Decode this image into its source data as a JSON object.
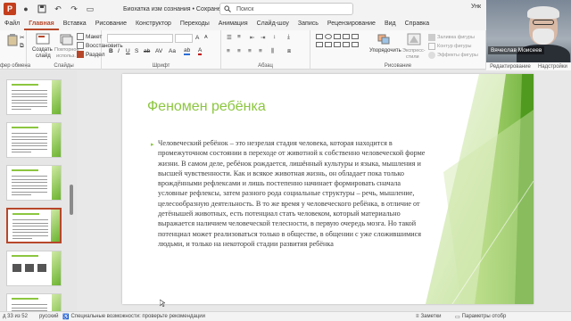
{
  "window": {
    "title": "Биохатка изм сознания • Сохранено в: этот компьютер",
    "search_placeholder": "Поиск",
    "user_name": "Вячеслав Моисеев",
    "user_short": "Унк"
  },
  "tabs": [
    {
      "label": "Файл"
    },
    {
      "label": "Главная",
      "active": true
    },
    {
      "label": "Вставка"
    },
    {
      "label": "Рисование"
    },
    {
      "label": "Конструктор"
    },
    {
      "label": "Переходы"
    },
    {
      "label": "Анимация"
    },
    {
      "label": "Слайд-шоу"
    },
    {
      "label": "Запись"
    },
    {
      "label": "Рецензирование"
    },
    {
      "label": "Вид"
    },
    {
      "label": "Справка"
    }
  ],
  "ribbon": {
    "groups": {
      "clipboard": "фер обмена",
      "slides": "Слайды",
      "font": "Шрифт",
      "paragraph": "Абзац",
      "drawing": "Рисование",
      "editing": "Редактирование",
      "addins": "Надстройки"
    },
    "slides": {
      "new_slide_line1": "Создать",
      "new_slide_line2": "слайд",
      "reuse_line1": "Повторное",
      "reuse_line2": "использ.",
      "layout": "Макет",
      "reset": "Восстановить",
      "section": "Раздел"
    },
    "drawing": {
      "arrange": "Упорядочить",
      "quick_styles_line1": "Экспресс-",
      "quick_styles_line2": "стили",
      "shape_fill": "Заливка фигуры",
      "shape_outline": "Контур фигуры",
      "shape_effects": "Эффекты фигуры"
    }
  },
  "thumbnails": [
    {
      "number": "",
      "selected": false,
      "has_images": false
    },
    {
      "number": "",
      "selected": false,
      "has_images": false
    },
    {
      "number": "",
      "selected": false,
      "has_images": false
    },
    {
      "number": "",
      "selected": true,
      "has_images": false
    },
    {
      "number": "",
      "selected": false,
      "has_images": true
    },
    {
      "number": "",
      "selected": false,
      "has_images": false
    }
  ],
  "slide": {
    "title": "Феномен ребёнка",
    "bullet": "▸",
    "body": "Человеческий ребёнок – это незрелая стадия человека, которая находится в промежуточном состоянии в переходе от животной к собственно человеческой форме жизни. В самом деле, ребёнок рождается, лишённый культуры и языка, мышления и высшей чувственности. Как и всякое животная жизнь, он обладает пока только врождёнными рефлексами и лишь постепенно начинает формировать сначала условные рефлексы, затем разного рода социальные структуры – речь, мышление, целесообразную деятельность. В то же время у человеческого ребёнка, в отличие от детёнышей животных, есть потенциал стать человеком, который материально выражается наличием человеческой телесности, в первую очередь мозга. Но такой потенциал может реализоваться только в обществе, в общении с уже сложившимися людьми, и только на некоторой стадии развития ребёнка"
  },
  "statusbar": {
    "slide_info": "д 33 из 52",
    "language": "русский",
    "accessibility": "Специальные возможности: проверьте рекомендации",
    "notes": "Заметки",
    "display": "Параметры отобр"
  },
  "colors": {
    "accent": "#b7472a",
    "slide_green": "#8cc63f",
    "slide_green_dark": "#6bb32f"
  }
}
